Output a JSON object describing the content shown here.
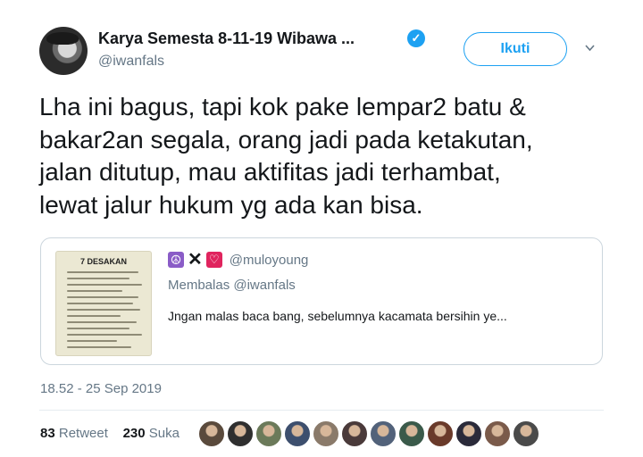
{
  "author": {
    "name": "Karya Semesta 8-11-19 Wibawa ...",
    "handle": "@iwanfals",
    "verified_icon": "verified-badge-icon",
    "follow_label": "Ikuti"
  },
  "tweet": {
    "lines": [
      "Lha ini bagus, tapi kok pake lempar2 batu &",
      "bakar2an segala, orang jadi pada ketakutan,",
      "jalan ditutup, mau aktifitas jadi terhambat,",
      "lewat jalur hukum yg ada kan bisa."
    ]
  },
  "quoted": {
    "image_title": "7 DESAKAN",
    "emoji_peace": "☮",
    "emoji_x": "✕",
    "emoji_heart": "♡",
    "handle": "@muloyoung",
    "replying": "Membalas @iwanfals",
    "text": "Jngan malas baca bang, sebelumnya kacamata bersihin ye..."
  },
  "timestamp": "18.52 - 25 Sep 2019",
  "stats": {
    "retweets_count": "83",
    "retweets_label": "Retweet",
    "likes_count": "230",
    "likes_label": "Suka"
  },
  "colors": {
    "accent": "#1da1f2",
    "secondary_text": "#657786",
    "border": "#ccd6dd"
  },
  "likers": [
    {
      "color": "#5a4a3c"
    },
    {
      "color": "#2f2f2f"
    },
    {
      "color": "#6b7a5a"
    },
    {
      "color": "#3d4f6e"
    },
    {
      "color": "#8a7a6a"
    },
    {
      "color": "#4a3a3a"
    },
    {
      "color": "#52627a"
    },
    {
      "color": "#3a5a4a"
    },
    {
      "color": "#6a3a2a"
    },
    {
      "color": "#2a2a3a"
    },
    {
      "color": "#7a5a4a"
    },
    {
      "color": "#4a4a4a"
    }
  ]
}
